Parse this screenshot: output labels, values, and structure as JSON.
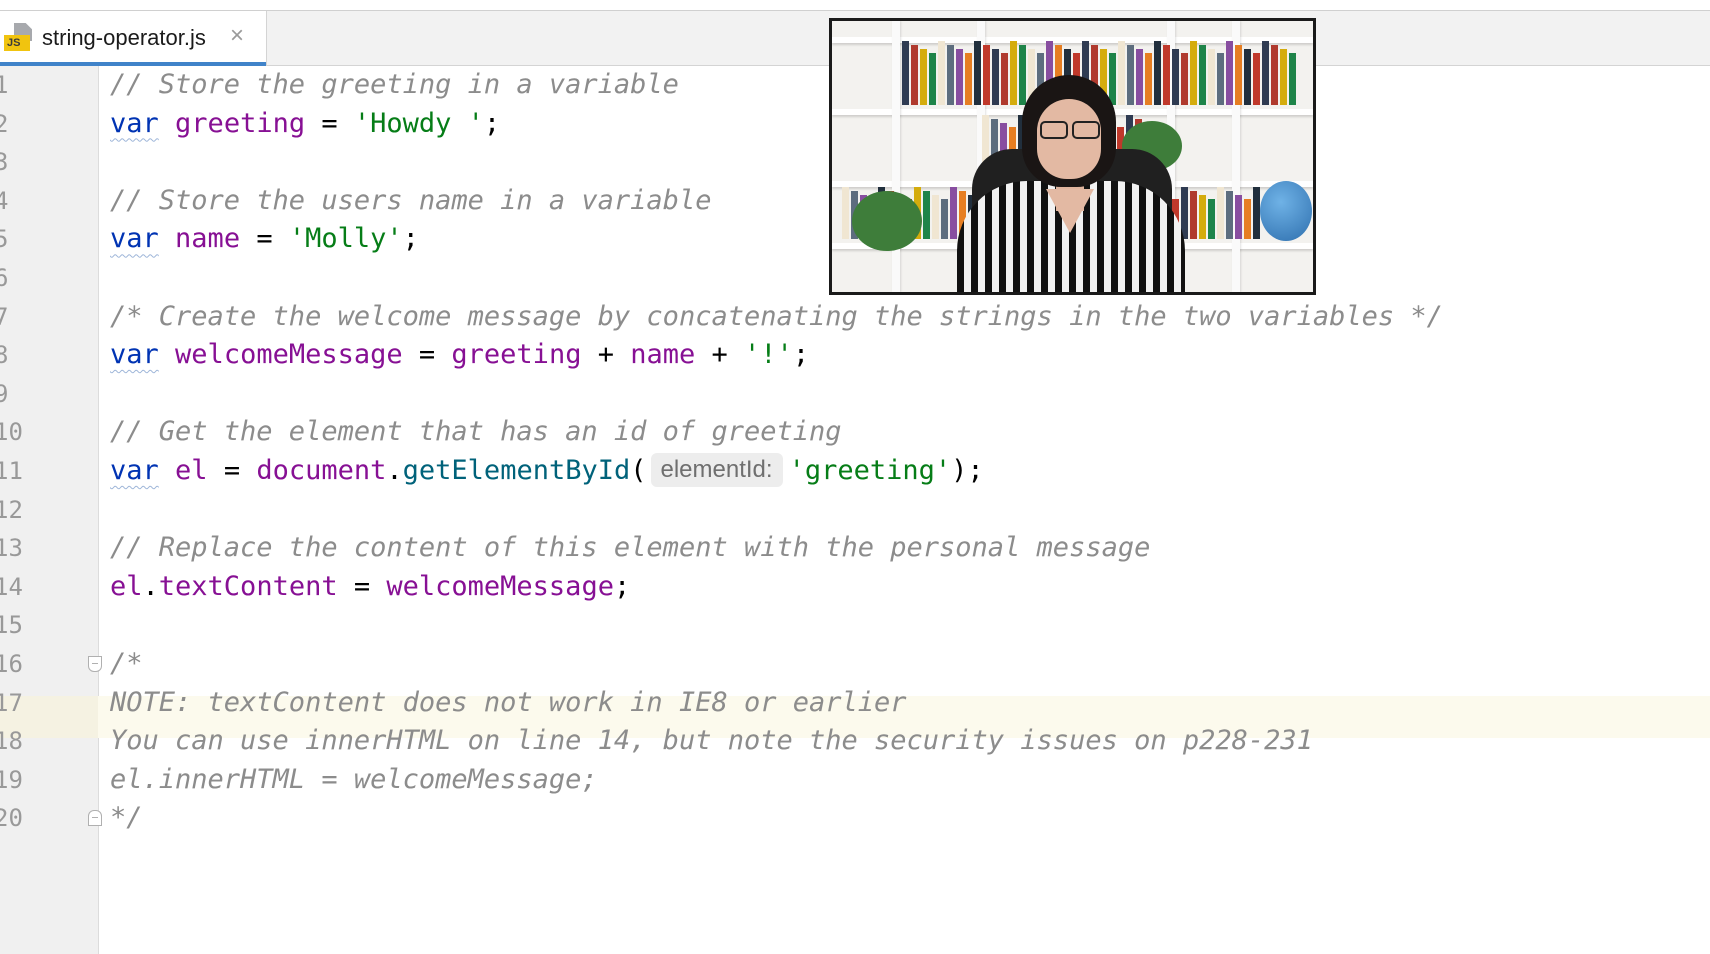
{
  "editor": {
    "tab": {
      "file_icon": "js-file-icon",
      "file_icon_badge": "JS",
      "filename": "string-operator.js",
      "close_glyph": "×"
    },
    "active_line": 16,
    "lines": [
      {
        "n": "1",
        "tokens": [
          {
            "t": "c",
            "v": "// Store the greeting in a variable"
          }
        ]
      },
      {
        "n": "2",
        "tokens": [
          {
            "t": "k",
            "v": "var"
          },
          {
            "t": "p",
            "v": " "
          },
          {
            "t": "v",
            "v": "greeting"
          },
          {
            "t": "p",
            "v": " = "
          },
          {
            "t": "s",
            "v": "'Howdy '"
          },
          {
            "t": "p",
            "v": ";"
          }
        ]
      },
      {
        "n": "3",
        "tokens": []
      },
      {
        "n": "4",
        "tokens": [
          {
            "t": "c",
            "v": "// Store the users name in a variable"
          }
        ]
      },
      {
        "n": "5",
        "tokens": [
          {
            "t": "k",
            "v": "var"
          },
          {
            "t": "p",
            "v": " "
          },
          {
            "t": "v",
            "v": "name"
          },
          {
            "t": "p",
            "v": " = "
          },
          {
            "t": "s",
            "v": "'Molly'"
          },
          {
            "t": "p",
            "v": ";"
          }
        ]
      },
      {
        "n": "6",
        "tokens": []
      },
      {
        "n": "7",
        "tokens": [
          {
            "t": "c",
            "v": "/* Create the welcome message by concatenating the strings in the two variables */"
          }
        ]
      },
      {
        "n": "8",
        "tokens": [
          {
            "t": "k",
            "v": "var"
          },
          {
            "t": "p",
            "v": " "
          },
          {
            "t": "v",
            "v": "welcomeMessage"
          },
          {
            "t": "p",
            "v": " = "
          },
          {
            "t": "v",
            "v": "greeting"
          },
          {
            "t": "p",
            "v": " + "
          },
          {
            "t": "v",
            "v": "name"
          },
          {
            "t": "p",
            "v": " + "
          },
          {
            "t": "s",
            "v": "'!'"
          },
          {
            "t": "p",
            "v": ";"
          }
        ]
      },
      {
        "n": "9",
        "tokens": []
      },
      {
        "n": "10",
        "tokens": [
          {
            "t": "c",
            "v": "// Get the element that has an id of greeting"
          }
        ]
      },
      {
        "n": "11",
        "tokens": [
          {
            "t": "k",
            "v": "var"
          },
          {
            "t": "p",
            "v": " "
          },
          {
            "t": "v",
            "v": "el"
          },
          {
            "t": "p",
            "v": " = "
          },
          {
            "t": "v",
            "v": "document"
          },
          {
            "t": "p",
            "v": "."
          },
          {
            "t": "f",
            "v": "getElementById"
          },
          {
            "t": "p",
            "v": "("
          },
          {
            "t": "h",
            "v": "elementId:"
          },
          {
            "t": "s",
            "v": "'greeting'"
          },
          {
            "t": "p",
            "v": ");"
          }
        ]
      },
      {
        "n": "12",
        "tokens": []
      },
      {
        "n": "13",
        "tokens": [
          {
            "t": "c",
            "v": "// Replace the content of this element with the personal message"
          }
        ]
      },
      {
        "n": "14",
        "tokens": [
          {
            "t": "v",
            "v": "el"
          },
          {
            "t": "p",
            "v": "."
          },
          {
            "t": "v",
            "v": "textContent"
          },
          {
            "t": "p",
            "v": " = "
          },
          {
            "t": "v",
            "v": "welcomeMessage"
          },
          {
            "t": "p",
            "v": ";"
          }
        ]
      },
      {
        "n": "15",
        "tokens": []
      },
      {
        "n": "16",
        "tokens": [
          {
            "t": "c",
            "v": "/*"
          }
        ],
        "fold": "open"
      },
      {
        "n": "17",
        "tokens": [
          {
            "t": "c",
            "v": "NOTE: textContent does not work in IE8 or earlier"
          }
        ]
      },
      {
        "n": "18",
        "tokens": [
          {
            "t": "c",
            "v": "You can use innerHTML on line 14, but note the security issues on p228-231"
          }
        ]
      },
      {
        "n": "19",
        "tokens": [
          {
            "t": "c",
            "v": "el.innerHTML = welcomeMessage;"
          }
        ]
      },
      {
        "n": "20",
        "tokens": [
          {
            "t": "c",
            "v": "*/"
          }
        ],
        "fold": "close"
      }
    ]
  },
  "video_overlay": {
    "icon": "webcam-video-feed"
  },
  "colors": {
    "keyword": "#0033b3",
    "identifier": "#871094",
    "string": "#067d17",
    "function": "#00627a",
    "comment": "#8c8c8c",
    "tab_accent": "#4083c9",
    "current_line": "#fcfaed"
  }
}
